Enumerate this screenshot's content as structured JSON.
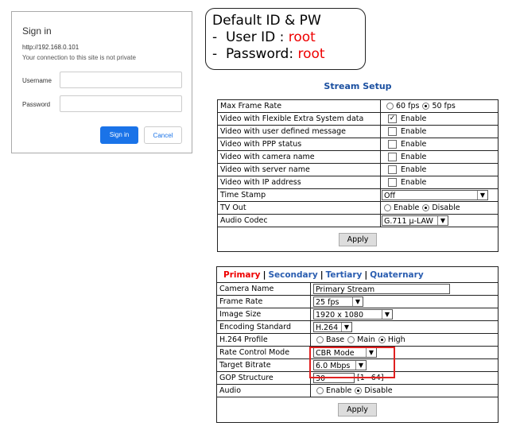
{
  "signin": {
    "title": "Sign in",
    "url": "http://192.168.0.101",
    "notice": "Your connection to this site is not private",
    "username_label": "Username",
    "username_value": "",
    "password_label": "Password",
    "password_value": "",
    "signin_button": "Sign in",
    "cancel_button": "Cancel",
    "accent": "#1a73e8"
  },
  "callout": {
    "title": "Default ID & PW",
    "line1_label": "-  User ID : ",
    "line1_value": "root",
    "line2_label": "-  Password: ",
    "line2_value": "root"
  },
  "stream_setup": {
    "title": "Stream Setup",
    "max_frame_rate": {
      "label": "Max Frame Rate",
      "opt1": "60 fps",
      "opt2": "50 fps",
      "selected": "50 fps"
    },
    "checks": [
      {
        "label": "Video with Flexible Extra System data",
        "option": "Enable",
        "checked": true
      },
      {
        "label": "Video with user defined message",
        "option": "Enable",
        "checked": false
      },
      {
        "label": "Video with PPP status",
        "option": "Enable",
        "checked": false
      },
      {
        "label": "Video with camera name",
        "option": "Enable",
        "checked": false
      },
      {
        "label": "Video with server name",
        "option": "Enable",
        "checked": false
      },
      {
        "label": "Video with IP address",
        "option": "Enable",
        "checked": false
      }
    ],
    "time_stamp": {
      "label": "Time Stamp",
      "value": "Off"
    },
    "tv_out": {
      "label": "TV Out",
      "opt1": "Enable",
      "opt2": "Disable",
      "selected": "Disable"
    },
    "audio_codec": {
      "label": "Audio Codec",
      "value": "G.711 μ-LAW"
    },
    "apply": "Apply"
  },
  "stream": {
    "tabs": [
      "Primary",
      "Secondary",
      "Tertiary",
      "Quaternary"
    ],
    "sep": "|",
    "active_tab": "Primary",
    "camera_name": {
      "label": "Camera Name",
      "value": "Primary Stream"
    },
    "frame_rate": {
      "label": "Frame Rate",
      "value": "25 fps"
    },
    "image_size": {
      "label": "Image Size",
      "value": "1920 x 1080"
    },
    "encoding": {
      "label": "Encoding Standard",
      "value": "H.264"
    },
    "profile": {
      "label": "H.264 Profile",
      "opt1": "Base",
      "opt2": "Main",
      "opt3": "High",
      "selected": "High"
    },
    "rate_control": {
      "label": "Rate Control Mode",
      "value": "CBR Mode"
    },
    "bitrate": {
      "label": "Target Bitrate",
      "value": "6.0 Mbps"
    },
    "gop": {
      "label": "GOP Structure",
      "value": "30",
      "range": "[1~64]"
    },
    "audio": {
      "label": "Audio",
      "opt1": "Enable",
      "opt2": "Disable",
      "selected": "Disable"
    },
    "apply": "Apply"
  }
}
